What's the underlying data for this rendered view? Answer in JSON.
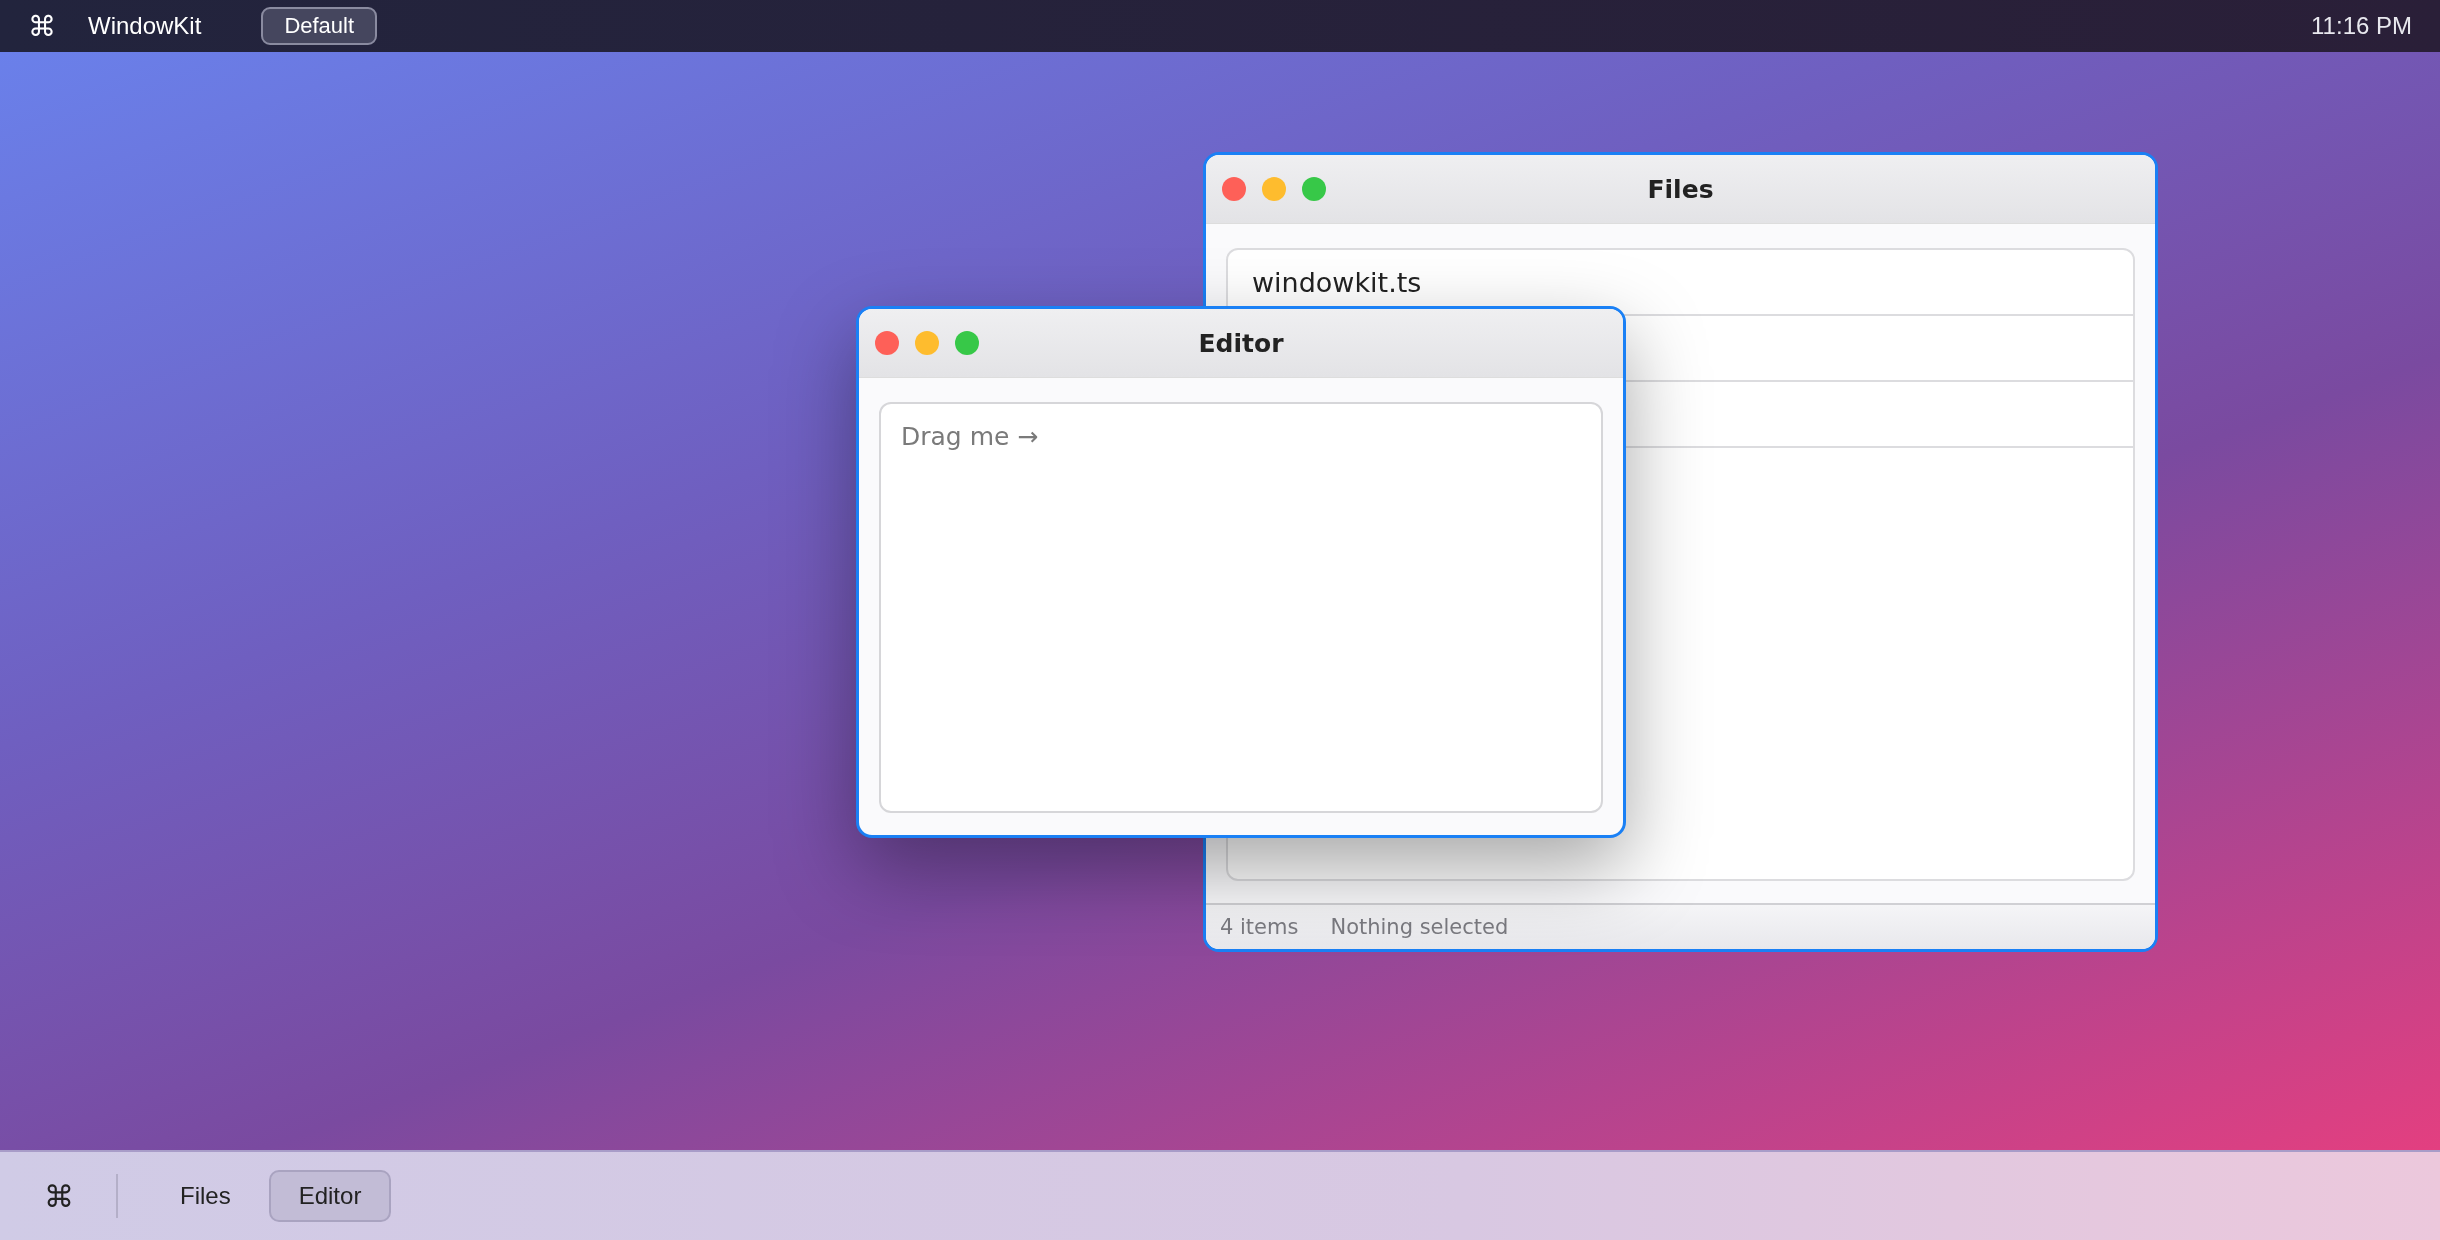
{
  "menu_bar": {
    "logo": "⌘",
    "app_name": "WindowKit",
    "theme_button": "Default",
    "clock": "11:16 PM"
  },
  "windows": [
    {
      "kind": "list",
      "title": "Files",
      "items": [
        "windowkit.ts"
      ],
      "status": [
        "4 items",
        "Nothing selected"
      ]
    },
    {
      "kind": "editor",
      "title": "Editor",
      "placeholder": "Drag me →"
    }
  ],
  "dock": {
    "logo": "⌘",
    "items": [
      {
        "label": "Files",
        "selected": false
      },
      {
        "label": "Editor",
        "selected": true
      }
    ]
  }
}
